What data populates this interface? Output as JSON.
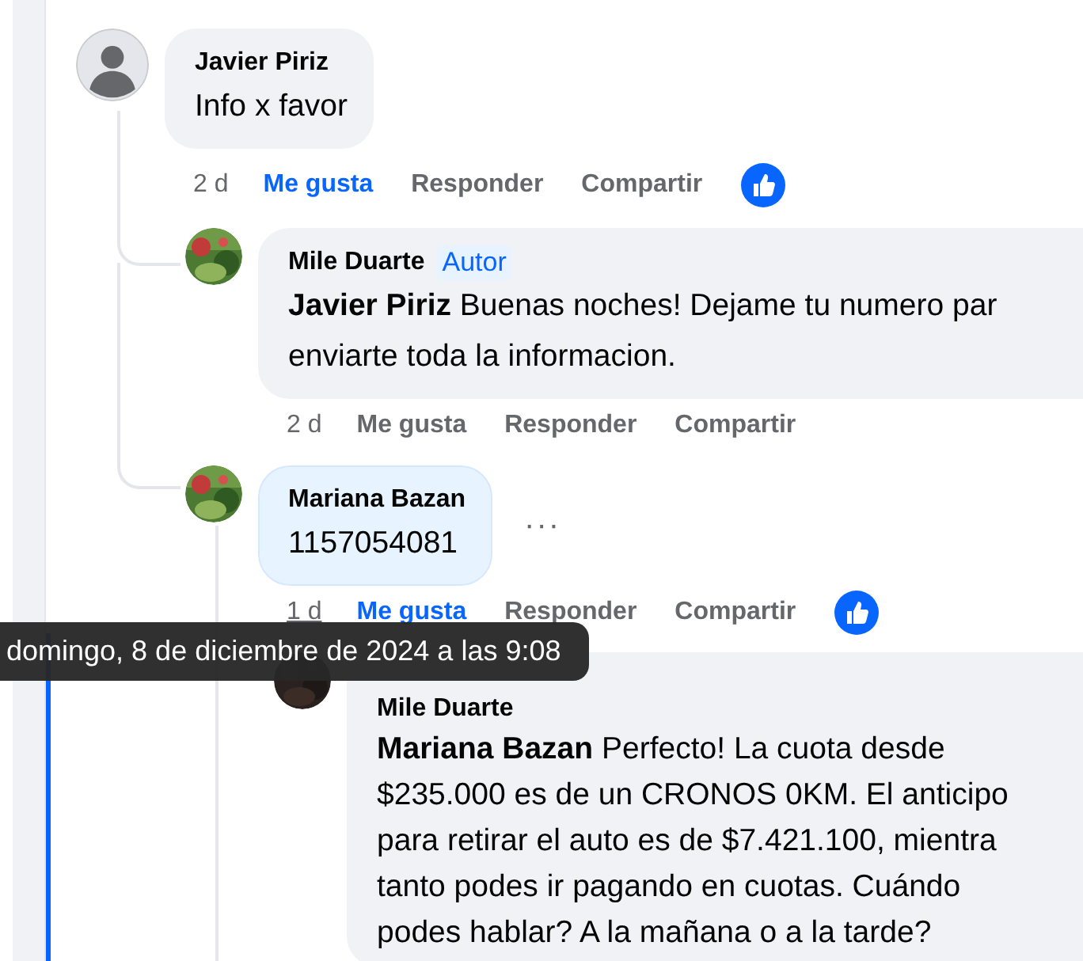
{
  "comments": [
    {
      "author": "Javier Piriz",
      "has_photo": false,
      "highlighted": false,
      "lines": [
        "Info x favor"
      ],
      "time": "2 d",
      "time_underlined": false,
      "like": "Me gusta",
      "like_selected": true,
      "reply": "Responder",
      "share": "Compartir",
      "reaction": true,
      "children": [
        {
          "author": "Mile Duarte",
          "badge": "Autor",
          "has_photo": true,
          "highlighted": false,
          "mention": "Javier Piriz",
          "lines": [
            "Buenas noches! Dejame tu numero par",
            "enviarte toda la informacion."
          ],
          "time": "2 d",
          "time_underlined": false,
          "like": "Me gusta",
          "like_selected": false,
          "reply": "Responder",
          "share": "Compartir",
          "reaction": false
        },
        {
          "author": "Mariana Bazan",
          "has_photo": true,
          "highlighted": true,
          "lines": [
            "1157054081"
          ],
          "more": "···",
          "time": "1 d",
          "time_underlined": true,
          "like": "Me gusta",
          "like_selected": true,
          "reply": "Responder",
          "share": "Compartir",
          "reaction": true,
          "children": [
            {
              "author": "Mile Duarte",
              "has_photo": true,
              "highlighted": false,
              "mention": "Mariana Bazan",
              "lines": [
                "Perfecto! La cuota desde",
                "$235.000 es de un CRONOS 0KM. El anticipo",
                "para retirar el auto es de $7.421.100, mientra",
                "tanto podes ir pagando en cuotas. Cuándo",
                "podes hablar? A la mañana o a la tarde?"
              ]
            }
          ]
        }
      ]
    }
  ],
  "tooltip": "domingo, 8 de diciembre de 2024 a las 9:08"
}
